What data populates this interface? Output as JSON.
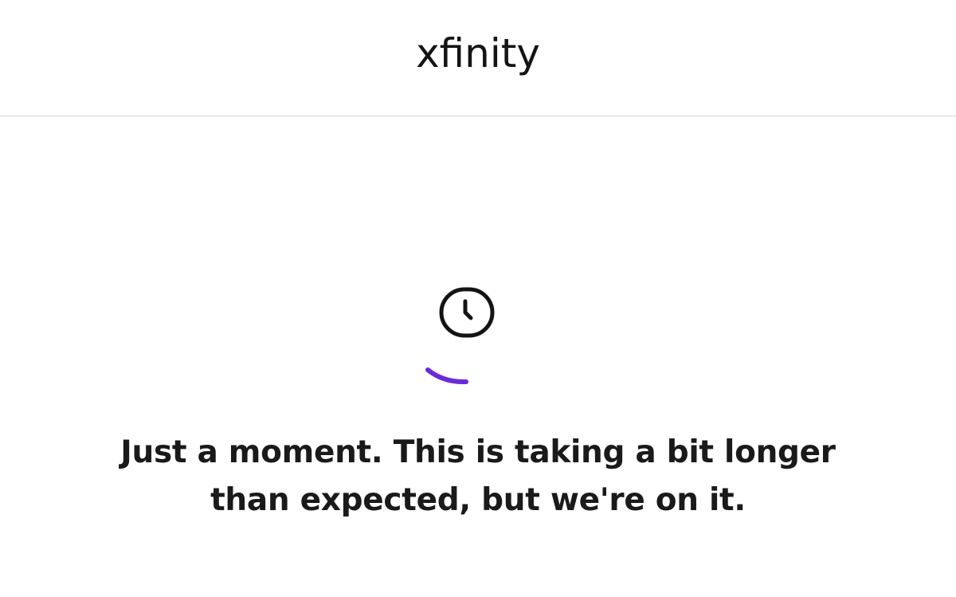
{
  "header": {
    "logo_text": "xfinity"
  },
  "status": {
    "icon": "clock-icon",
    "spinner_icon": "loading-spinner-icon",
    "message_line1": "Just a moment. This is taking a bit longer",
    "message_line2": "than expected, but we're on it."
  },
  "colors": {
    "accent": "#6a2bd9",
    "text": "#1a1a1a",
    "divider": "#d6d6d6"
  }
}
